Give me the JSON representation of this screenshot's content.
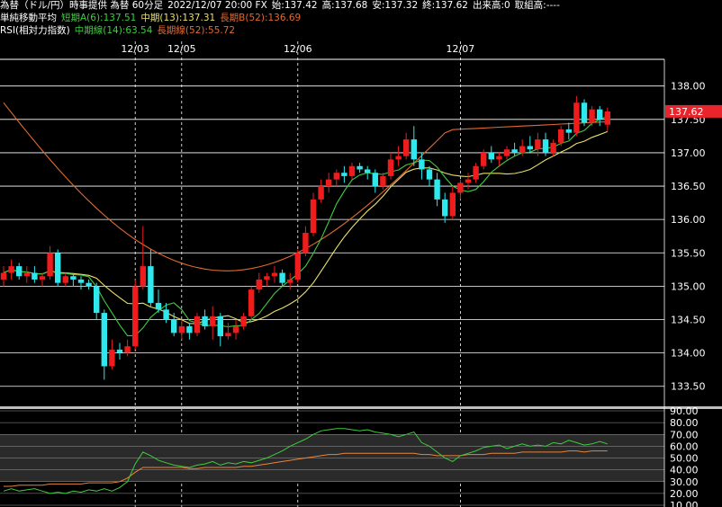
{
  "header": {
    "instrument": "為替（ドル/円）時事提供 為替 60分足",
    "datetime": "2022/12/07 20:00 FX",
    "open_label": "始:",
    "open": "137.42",
    "high_label": "高:",
    "high": "137.68",
    "low_label": "安:",
    "low": "137.32",
    "close_label": "終:",
    "close": "137.62",
    "volume": "出来高:0",
    "turnover": "取組高:----"
  },
  "ma_legend": {
    "title": "単純移動平均",
    "short": "短期A(6):137.51",
    "mid": "中期(13):137.31",
    "long": "長期B(52):136.69"
  },
  "rsi_legend": {
    "title": "RSI(相対力指数)",
    "mid": "中期線(14):63.54",
    "long": "長期線(52):55.72"
  },
  "colors": {
    "up": "#ee1c1c",
    "down": "#2ee8ee",
    "ma_short": "#3fcc3f",
    "ma_mid": "#e8e06a",
    "ma_long": "#e06a30",
    "rsi_mid": "#3fcc3f",
    "rsi_long": "#e8843c",
    "grid": "#ffffff",
    "price_tag": "#e8242c"
  },
  "chart_data": [
    {
      "type": "candlestick",
      "timeframe": "60分足",
      "ylim": [
        133.2,
        138.4
      ],
      "yticks": [
        "138.00",
        "137.50",
        "137.00",
        "136.50",
        "136.00",
        "135.50",
        "135.00",
        "134.50",
        "134.00",
        "133.50"
      ],
      "xlabels": [
        "12/03",
        "12/05",
        "12/06",
        "12/07"
      ],
      "last_price": "137.62",
      "candles": [
        [
          135.1,
          135.3,
          135.0,
          135.2
        ],
        [
          135.2,
          135.4,
          135.1,
          135.3
        ],
        [
          135.3,
          135.35,
          135.1,
          135.15
        ],
        [
          135.15,
          135.3,
          135.05,
          135.2
        ],
        [
          135.2,
          135.3,
          135.05,
          135.1
        ],
        [
          135.1,
          135.2,
          135.0,
          135.15
        ],
        [
          135.15,
          135.6,
          135.1,
          135.5
        ],
        [
          135.5,
          135.55,
          135.0,
          135.05
        ],
        [
          135.05,
          135.2,
          135.0,
          135.15
        ],
        [
          135.15,
          135.2,
          135.0,
          135.1
        ],
        [
          135.1,
          135.15,
          134.95,
          135.05
        ],
        [
          135.05,
          135.1,
          134.95,
          135.0
        ],
        [
          135.0,
          135.05,
          134.5,
          134.6
        ],
        [
          134.6,
          134.65,
          133.6,
          133.8
        ],
        [
          133.8,
          134.2,
          133.75,
          134.05
        ],
        [
          134.05,
          134.15,
          133.9,
          134.0
        ],
        [
          134.0,
          134.2,
          133.95,
          134.1
        ],
        [
          134.1,
          135.1,
          134.05,
          135.0
        ],
        [
          135.0,
          135.9,
          134.95,
          135.3
        ],
        [
          135.3,
          135.55,
          134.7,
          134.75
        ],
        [
          134.75,
          134.95,
          134.6,
          134.65
        ],
        [
          134.65,
          134.75,
          134.45,
          134.5
        ],
        [
          134.5,
          134.6,
          134.25,
          134.3
        ],
        [
          134.3,
          134.5,
          134.2,
          134.4
        ],
        [
          134.4,
          134.45,
          134.2,
          134.3
        ],
        [
          134.3,
          134.6,
          134.25,
          134.55
        ],
        [
          134.55,
          134.65,
          134.35,
          134.4
        ],
        [
          134.4,
          134.7,
          134.2,
          134.55
        ],
        [
          134.55,
          134.6,
          134.1,
          134.25
        ],
        [
          134.25,
          134.45,
          134.2,
          134.3
        ],
        [
          134.3,
          134.5,
          134.2,
          134.4
        ],
        [
          134.4,
          134.6,
          134.35,
          134.55
        ],
        [
          134.55,
          135.0,
          134.5,
          134.95
        ],
        [
          134.95,
          135.2,
          134.9,
          135.1
        ],
        [
          135.1,
          135.2,
          135.0,
          135.15
        ],
        [
          135.15,
          135.3,
          135.05,
          135.2
        ],
        [
          135.2,
          135.25,
          135.0,
          135.05
        ],
        [
          135.05,
          135.2,
          134.95,
          135.1
        ],
        [
          135.1,
          135.55,
          135.05,
          135.5
        ],
        [
          135.5,
          135.9,
          135.45,
          135.8
        ],
        [
          135.8,
          136.4,
          135.75,
          136.3
        ],
        [
          136.3,
          136.6,
          136.25,
          136.5
        ],
        [
          136.5,
          136.7,
          136.4,
          136.6
        ],
        [
          136.6,
          136.75,
          136.5,
          136.7
        ],
        [
          136.7,
          136.8,
          136.55,
          136.65
        ],
        [
          136.65,
          136.85,
          136.6,
          136.8
        ],
        [
          136.8,
          136.85,
          136.7,
          136.75
        ],
        [
          136.75,
          136.8,
          136.6,
          136.7
        ],
        [
          136.7,
          136.75,
          136.4,
          136.5
        ],
        [
          136.5,
          136.7,
          136.45,
          136.65
        ],
        [
          136.65,
          137.0,
          136.6,
          136.9
        ],
        [
          136.9,
          137.1,
          136.8,
          136.95
        ],
        [
          136.95,
          137.3,
          136.9,
          137.2
        ],
        [
          137.2,
          137.4,
          136.8,
          136.9
        ],
        [
          136.9,
          137.0,
          136.6,
          136.75
        ],
        [
          136.75,
          136.8,
          136.5,
          136.6
        ],
        [
          136.6,
          136.7,
          136.2,
          136.3
        ],
        [
          136.3,
          136.4,
          135.95,
          136.05
        ],
        [
          136.05,
          136.5,
          136.0,
          136.4
        ],
        [
          136.4,
          136.6,
          136.3,
          136.55
        ],
        [
          136.55,
          136.7,
          136.45,
          136.6
        ],
        [
          136.6,
          136.85,
          136.55,
          136.8
        ],
        [
          136.8,
          137.05,
          136.75,
          137.0
        ],
        [
          137.0,
          137.1,
          136.85,
          136.9
        ],
        [
          136.9,
          137.0,
          136.8,
          136.95
        ],
        [
          136.95,
          137.1,
          136.9,
          137.05
        ],
        [
          137.05,
          137.15,
          136.95,
          137.0
        ],
        [
          137.0,
          137.2,
          136.95,
          137.1
        ],
        [
          137.1,
          137.25,
          137.0,
          137.05
        ],
        [
          137.05,
          137.3,
          136.95,
          137.2
        ],
        [
          137.2,
          137.3,
          136.95,
          137.0
        ],
        [
          137.0,
          137.2,
          136.95,
          137.15
        ],
        [
          137.15,
          137.4,
          137.1,
          137.35
        ],
        [
          137.35,
          137.45,
          137.2,
          137.3
        ],
        [
          137.3,
          137.85,
          137.25,
          137.75
        ],
        [
          137.75,
          137.8,
          137.4,
          137.45
        ],
        [
          137.45,
          137.7,
          137.4,
          137.65
        ],
        [
          137.65,
          137.7,
          137.4,
          137.5
        ],
        [
          137.42,
          137.68,
          137.32,
          137.62
        ]
      ],
      "series": [
        {
          "name": "短期A(6)",
          "values_last": "137.51"
        },
        {
          "name": "中期(13)",
          "values_last": "137.31"
        },
        {
          "name": "長期B(52)",
          "values_last": "136.69"
        }
      ]
    },
    {
      "type": "line",
      "ylim": [
        10,
        90
      ],
      "yticks": [
        "90.00",
        "80.00",
        "70.00",
        "60.00",
        "50.00",
        "40.00",
        "30.00",
        "20.00",
        "10.00"
      ],
      "bands": [
        [
          30,
          70
        ]
      ],
      "series": [
        {
          "name": "中期線(14)",
          "values": [
            22,
            24,
            22,
            23,
            24,
            22,
            20,
            21,
            20,
            22,
            21,
            23,
            22,
            24,
            22,
            25,
            30,
            45,
            55,
            52,
            48,
            46,
            44,
            43,
            42,
            44,
            45,
            47,
            44,
            46,
            45,
            47,
            46,
            48,
            50,
            53,
            56,
            60,
            63,
            66,
            70,
            73,
            74,
            75,
            75,
            74,
            73,
            74,
            72,
            71,
            70,
            68,
            70,
            72,
            63,
            60,
            55,
            50,
            47,
            52,
            54,
            56,
            59,
            60,
            61,
            58,
            60,
            62,
            60,
            61,
            60,
            63,
            62,
            65,
            63,
            61,
            62,
            64,
            62
          ]
        },
        {
          "name": "長期線(52)",
          "values": [
            26,
            26,
            27,
            27,
            27,
            27,
            28,
            28,
            28,
            28,
            28,
            29,
            29,
            29,
            29,
            30,
            33,
            38,
            42,
            42,
            42,
            42,
            42,
            42,
            41,
            41,
            42,
            42,
            42,
            42,
            42,
            43,
            43,
            44,
            45,
            46,
            47,
            48,
            49,
            50,
            51,
            52,
            53,
            53,
            54,
            54,
            54,
            54,
            54,
            54,
            54,
            54,
            54,
            54,
            53,
            53,
            52,
            52,
            52,
            52,
            53,
            53,
            53,
            54,
            54,
            54,
            54,
            55,
            55,
            55,
            55,
            55,
            55,
            56,
            56,
            55,
            56,
            56,
            56
          ]
        }
      ]
    }
  ]
}
